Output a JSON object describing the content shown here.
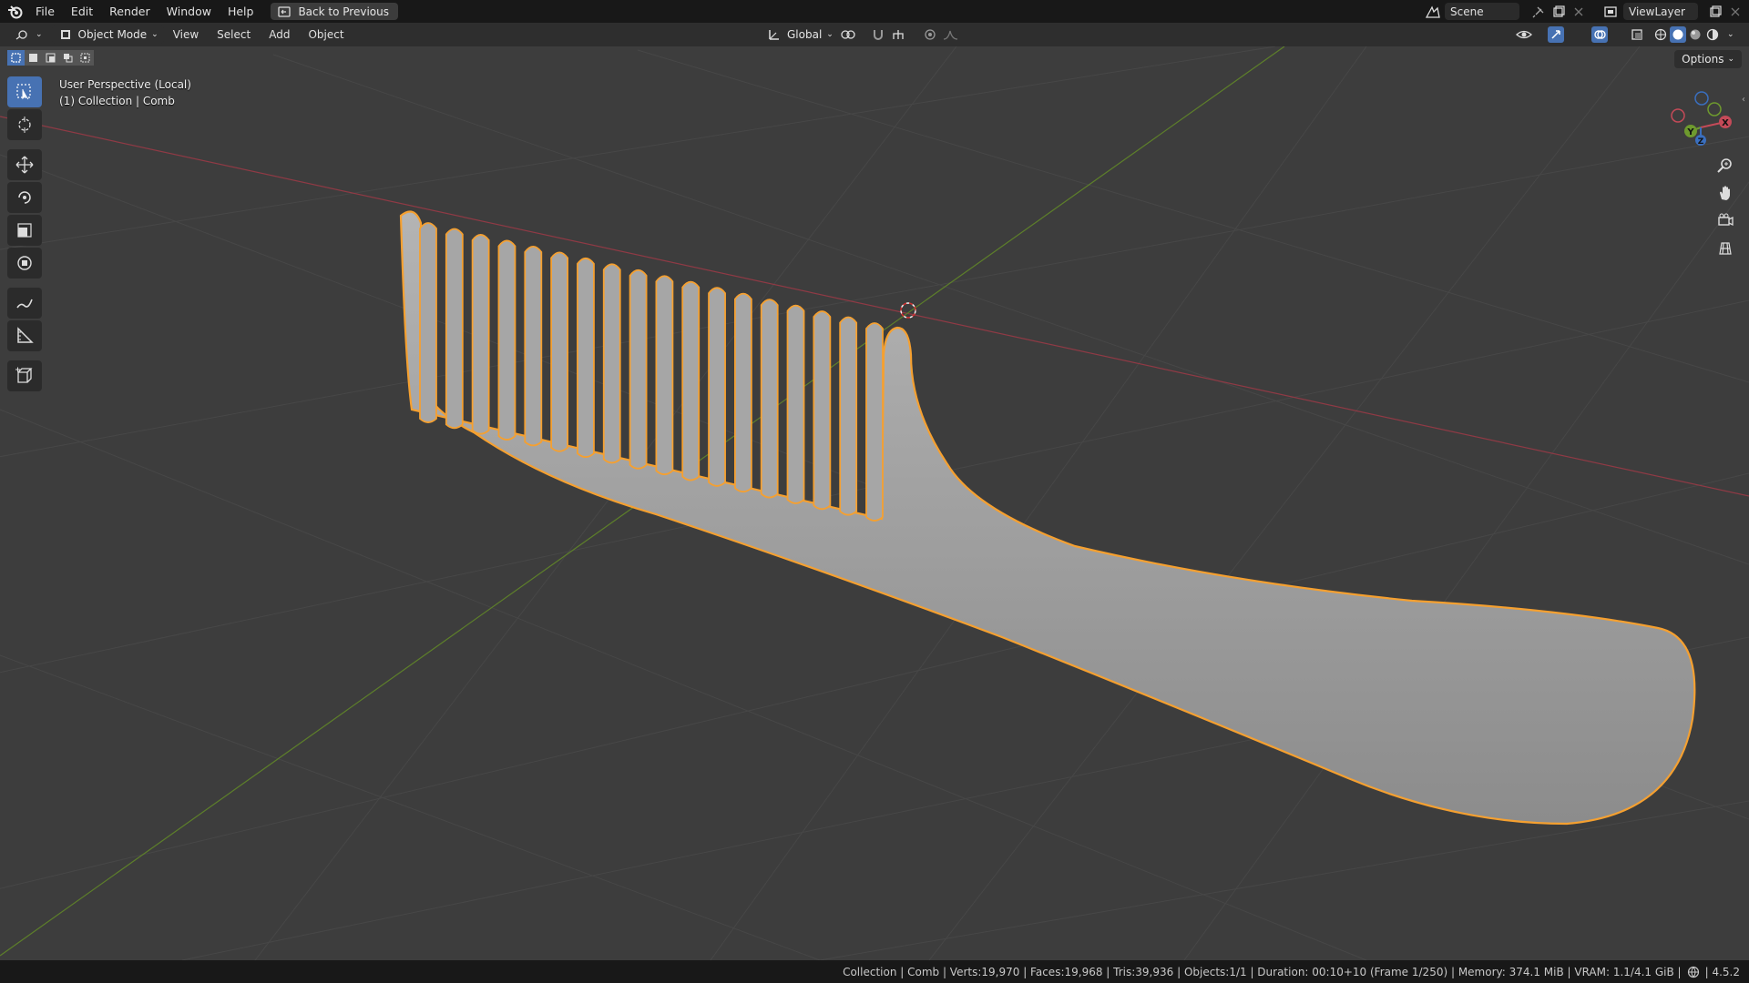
{
  "topbar": {
    "menu": [
      "File",
      "Edit",
      "Render",
      "Window",
      "Help"
    ],
    "back_label": "Back to Previous",
    "scene": "Scene",
    "view_layer": "ViewLayer"
  },
  "viewport_header": {
    "mode": "Object Mode",
    "menus": [
      "View",
      "Select",
      "Add",
      "Object"
    ],
    "transform_orientation": "Global",
    "options_label": "Options"
  },
  "viewport": {
    "perspective": "User Perspective (Local)",
    "collection_info": "(1) Collection | Comb"
  },
  "gizmo": {
    "x": "X",
    "y": "Y",
    "z": "Z"
  },
  "statusbar": {
    "text": "Collection | Comb | Verts:19,970 | Faces:19,968 | Tris:39,936 | Objects:1/1 | Duration: 00:10+10 (Frame 1/250) | Memory: 374.1 MiB | VRAM: 1.1/4.1 GiB | ",
    "version": "4.5.2"
  },
  "colors": {
    "accent": "#4772b3",
    "selection_outline": "#f5a030",
    "x_axis": "#c44a58",
    "y_axis": "#6e9a2e"
  }
}
